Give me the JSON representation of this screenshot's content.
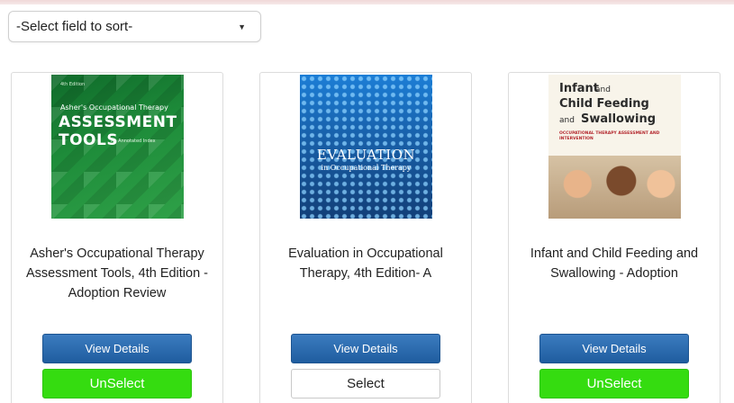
{
  "sort": {
    "label": "-Select field to sort-",
    "caret": "▼"
  },
  "colors": {
    "view_button": "#2464a8",
    "unselect_button": "#35dc10",
    "select_button": "#ffffff"
  },
  "books": [
    {
      "title": "Asher's Occupational Therapy Assessment Tools, 4th Edition - Adoption Review",
      "cover": {
        "small": "4th Edition",
        "line1": "Asher's Occupational Therapy",
        "line2": "ASSESSMENT",
        "line3": "TOOLS",
        "tag": "An Annotated Index"
      },
      "view_label": "View Details",
      "action_label": "UnSelect",
      "selected": true
    },
    {
      "title": "Evaluation in Occupational Therapy, 4th Edition- A",
      "cover": {
        "line1": "EVALUATION",
        "line2": "in Occupational Therapy"
      },
      "view_label": "View Details",
      "action_label": "Select",
      "selected": false
    },
    {
      "title": "Infant and Child Feeding and Swallowing - Adoption",
      "cover": {
        "line1": "Infant",
        "line1b": "and",
        "line2": "Child Feeding",
        "line3": "and",
        "line3b": "Swallowing",
        "tag": "OCCUPATIONAL THERAPY ASSESSMENT AND INTERVENTION"
      },
      "view_label": "View Details",
      "action_label": "UnSelect",
      "selected": true
    }
  ]
}
